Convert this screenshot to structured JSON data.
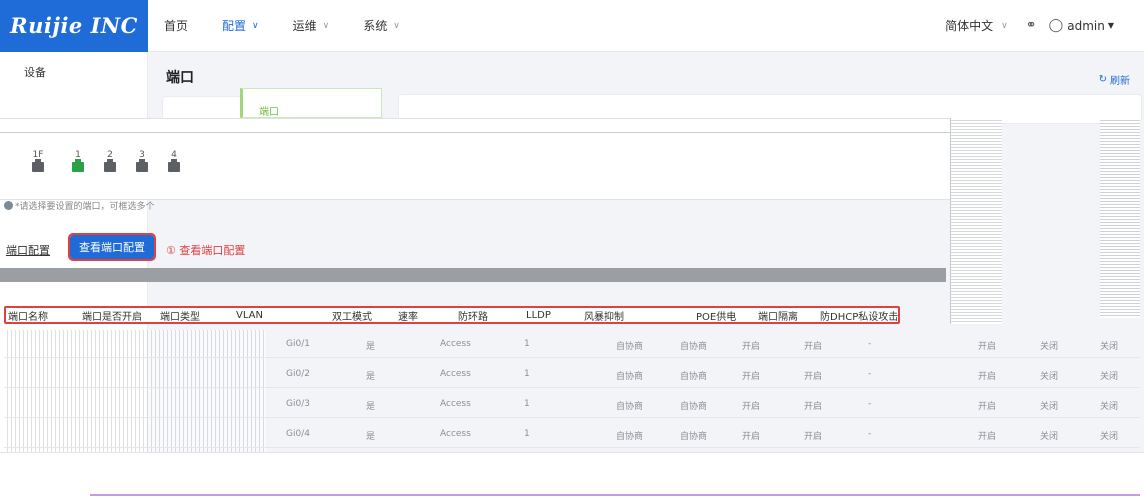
{
  "header": {
    "logo": "Ruijie INC",
    "nav": [
      {
        "label": "首页",
        "active": false,
        "dropdown": false
      },
      {
        "label": "配置",
        "active": true,
        "dropdown": true
      },
      {
        "label": "运维",
        "active": false,
        "dropdown": true
      },
      {
        "label": "系统",
        "active": false,
        "dropdown": true
      }
    ],
    "language": "简体中文",
    "user": "admin"
  },
  "sidebar": {
    "items": [
      {
        "label": "设备"
      }
    ]
  },
  "main": {
    "title": "端口",
    "refresh_label": "刷新",
    "tab_label": "端口",
    "ports": [
      {
        "label": "1F",
        "status": "down"
      },
      {
        "label": "1",
        "status": "up"
      },
      {
        "label": "2",
        "status": "down"
      },
      {
        "label": "3",
        "status": "down"
      },
      {
        "label": "4",
        "status": "down"
      }
    ],
    "hint": "*请选择要设置的端口，可框选多个",
    "config_button": "端口配置",
    "view_button": "查看端口配置",
    "annotation": "① 查看端口配置"
  },
  "table": {
    "columns": [
      "端口名称",
      "端口是否开启",
      "端口类型",
      "VLAN",
      "双工模式",
      "速率",
      "防环路",
      "LLDP",
      "风暴抑制",
      "POE供电",
      "端口隔离",
      "防DHCP私设攻击"
    ],
    "rows": [
      {
        "name": "Gi0/1",
        "enabled": "是",
        "type": "Access",
        "vlan": "1",
        "c5": "自协商",
        "c6": "自协商",
        "c7": "开启",
        "c8": "开启",
        "c9": "-",
        "c10": "开启",
        "c11": "关闭",
        "c12": "关闭"
      },
      {
        "name": "Gi0/2",
        "enabled": "是",
        "type": "Access",
        "vlan": "1",
        "c5": "自协商",
        "c6": "自协商",
        "c7": "开启",
        "c8": "开启",
        "c9": "-",
        "c10": "开启",
        "c11": "关闭",
        "c12": "关闭"
      },
      {
        "name": "Gi0/3",
        "enabled": "是",
        "type": "Access",
        "vlan": "1",
        "c5": "自协商",
        "c6": "自协商",
        "c7": "开启",
        "c8": "开启",
        "c9": "-",
        "c10": "开启",
        "c11": "关闭",
        "c12": "关闭"
      },
      {
        "name": "Gi0/4",
        "enabled": "是",
        "type": "Access",
        "vlan": "1",
        "c5": "自协商",
        "c6": "自协商",
        "c7": "开启",
        "c8": "开启",
        "c9": "-",
        "c10": "开启",
        "c11": "关闭",
        "c12": "关闭"
      }
    ]
  },
  "colors": {
    "primary": "#1f6bd8",
    "annotation": "#e04040",
    "port_up": "#2aa148",
    "port_down": "#5c5f63"
  }
}
